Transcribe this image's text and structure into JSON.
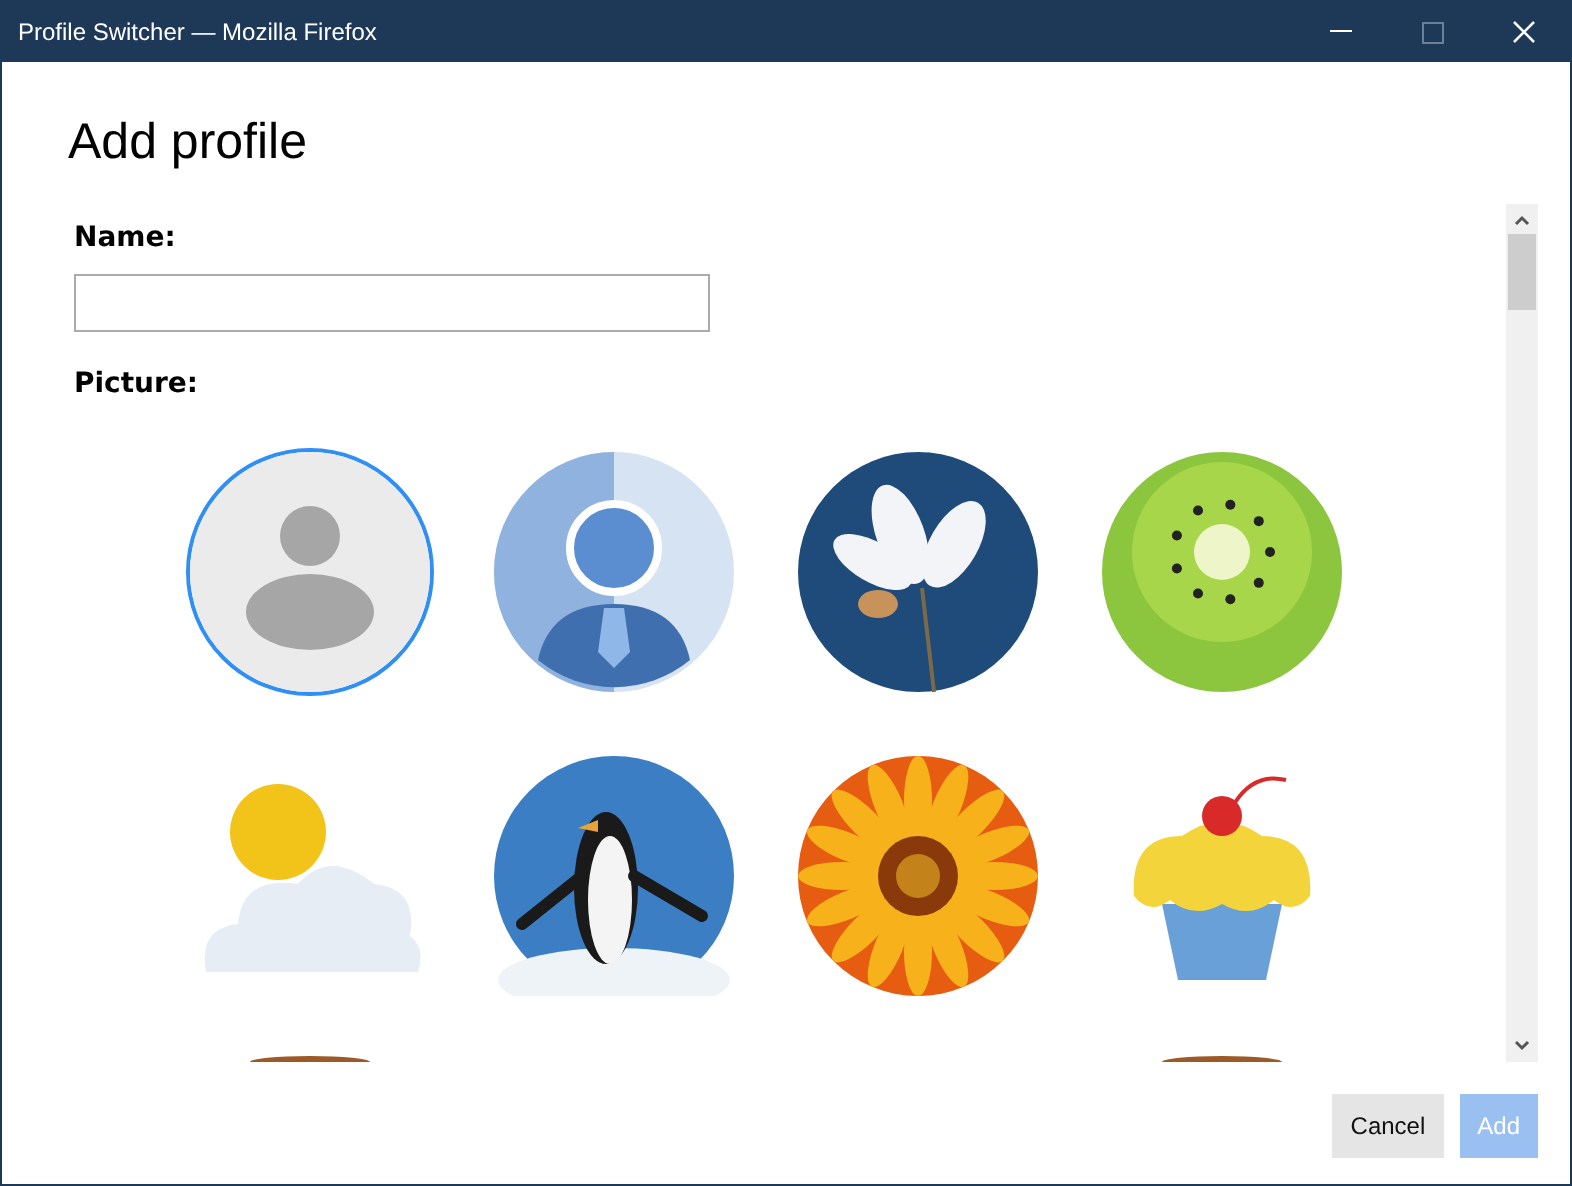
{
  "window": {
    "title": "Profile Switcher — Mozilla Firefox"
  },
  "heading": "Add profile",
  "name_field": {
    "label": "Name:"
  },
  "picture_label": "Picture:",
  "pictures": [
    {
      "kind": "default",
      "selected": true
    },
    {
      "kind": "person",
      "selected": false
    },
    {
      "kind": "flower",
      "selected": false
    },
    {
      "kind": "kiwi",
      "selected": false
    },
    {
      "kind": "weather",
      "selected": false
    },
    {
      "kind": "penguin",
      "selected": false
    },
    {
      "kind": "daisy",
      "selected": false
    },
    {
      "kind": "cupcake",
      "selected": false
    },
    {
      "kind": "cut",
      "selected": false
    },
    {
      "kind": "cut",
      "selected": false
    }
  ],
  "buttons": [
    {
      "label": "Cancel",
      "disabled": false
    },
    {
      "label": "Add",
      "disabled": true
    }
  ]
}
